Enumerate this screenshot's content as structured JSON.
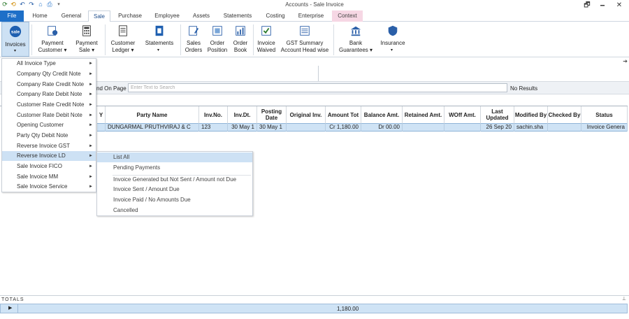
{
  "window": {
    "title": "Accounts - Sale Invoice",
    "minimize": "🗕",
    "restore": "🗗",
    "close": "✕"
  },
  "tabs": [
    "File",
    "Home",
    "General",
    "Sale",
    "Purchase",
    "Employee",
    "Assets",
    "Statements",
    "Costing",
    "Enterprise",
    "Context"
  ],
  "ribbon": {
    "invoices": "Invoices",
    "payment_customer": [
      "Payment",
      "Customer"
    ],
    "payment_sale": [
      "Payment",
      "Sale"
    ],
    "customer_ledger": [
      "Customer",
      "Ledger"
    ],
    "statements": "Statements",
    "sales_orders": [
      "Sales",
      "Orders"
    ],
    "order_position": [
      "Order",
      "Position"
    ],
    "order_book": [
      "Order",
      "Book"
    ],
    "invoice_waived": [
      "Invoice",
      "Waived"
    ],
    "gst_summary": [
      "GST Summary",
      "Account Head wise"
    ],
    "bank_guarantees": [
      "Bank",
      "Guarantees"
    ],
    "insurance": "Insurance",
    "sale_icon_text": "sale"
  },
  "search": {
    "label": "nd On Page",
    "placeholder": "Enter Text to Search",
    "result": "No Results"
  },
  "grid": {
    "headers": [
      "Y",
      "Party Name",
      "Inv.No.",
      "Inv.Dt.",
      "Posting Date",
      "Original Inv.",
      "Amount Tot",
      "Balance Amt.",
      "Retained Amt.",
      "WOff Amt.",
      "Last Updated",
      "Modified By",
      "Checked By",
      "Status"
    ],
    "row": [
      "",
      "DUNGARMAL  PRUTHVIRAJ  & C",
      "123",
      "30 May 1",
      "30 May 1",
      "",
      "Cr 1,180.00",
      "Dr 00.00",
      "",
      "",
      "26 Sep 20",
      "sachin.sha",
      "",
      "Invoice Genera"
    ]
  },
  "menu": [
    "All Invoice Type",
    "Company Qty Credit Note",
    "Company Rate Credit Note",
    "Company Rate Debit Note",
    "Customer Rate Credit Note",
    "Customer Rate Debit Note",
    "Opening Customer",
    "Party Qty Debit Note",
    "Reverse Invoice GST",
    "Reverse Invoice LD",
    "Sale Invoice FICO",
    "Sale Invoice MM",
    "Sale Invoice Service"
  ],
  "submenu": [
    "List All",
    "Pending Payments",
    "Invoice Generated but Not Sent / Amount not Due",
    "Invoice Sent / Amount Due",
    "Invoice Paid / No Amounts Due",
    "Cancelled"
  ],
  "totals": {
    "label": "TOTALS",
    "value": "1,180.00"
  },
  "colors": {
    "accent": "#1e6fc8",
    "selection": "#cfe3f5",
    "context_tab": "#f6d7e4"
  }
}
